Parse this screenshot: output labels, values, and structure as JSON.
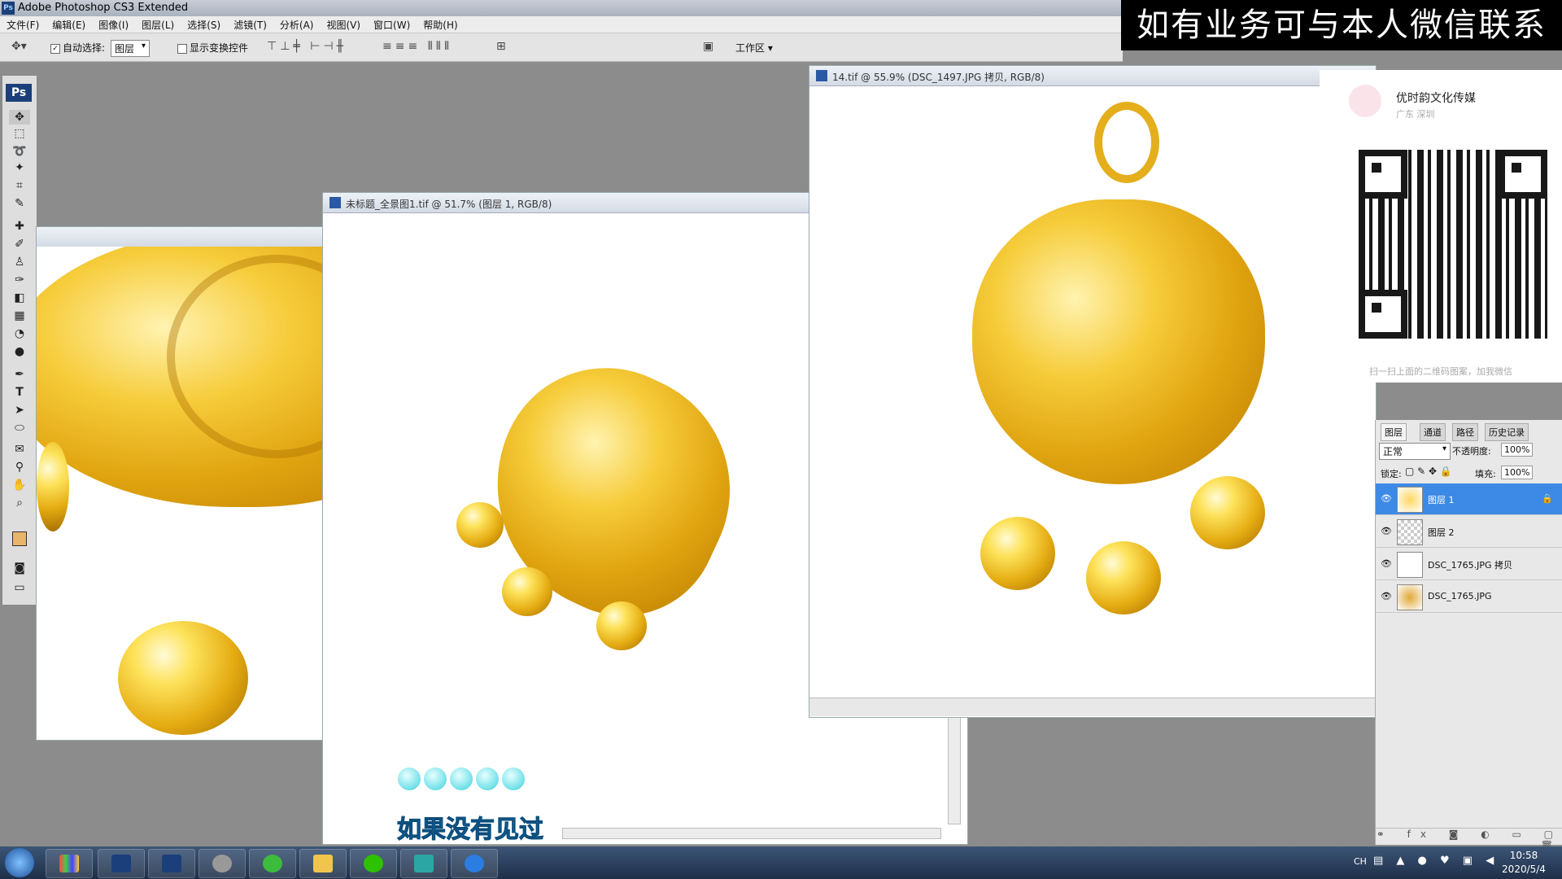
{
  "app": {
    "title": "Adobe Photoshop CS3 Extended",
    "ps_label": "Ps"
  },
  "menu": [
    "文件(F)",
    "编辑(E)",
    "图像(I)",
    "图层(L)",
    "选择(S)",
    "滤镜(T)",
    "分析(A)",
    "视图(V)",
    "窗口(W)",
    "帮助(H)"
  ],
  "options": {
    "auto_select_label": "自动选择:",
    "auto_select_value": "图层",
    "show_transform_label": "显示变换控件",
    "workspace_label": "工作区"
  },
  "windows": {
    "left_doc": {
      "title": ""
    },
    "center_doc": {
      "title": "未标题_全景图1.tif @ 51.7% (图层 1, RGB/8)"
    },
    "right_doc": {
      "title": "14.tif @ 55.9% (DSC_1497.JPG 拷贝, RGB/8)"
    }
  },
  "banner": "如有业务可与本人微信联系",
  "qr_card": {
    "name": "优时韵文化传媒",
    "location": "广东 深圳",
    "hint": "扫一扫上面的二维码图案，加我微信"
  },
  "layers_panel": {
    "tabs": [
      "图层",
      "通道",
      "路径",
      "历史记录"
    ],
    "blend_mode": "正常",
    "opacity_label": "不透明度:",
    "opacity_value": "100%",
    "lock_label": "锁定:",
    "fill_label": "填充:",
    "fill_value": "100%",
    "layers": [
      {
        "name": "图层 1",
        "selected": true
      },
      {
        "name": "图层 2",
        "selected": false
      },
      {
        "name": "DSC_1765.JPG 拷贝",
        "selected": false
      },
      {
        "name": "DSC_1765.JPG",
        "selected": false
      }
    ]
  },
  "subtitle": "如果没有见过",
  "taskbar": {
    "lang": "CH",
    "time": "10:58",
    "date": "2020/5/4"
  },
  "colors": {
    "banner_bg": "#000000",
    "layer_selected": "#3d8ae6",
    "subtitle": "#1f8fd6"
  }
}
